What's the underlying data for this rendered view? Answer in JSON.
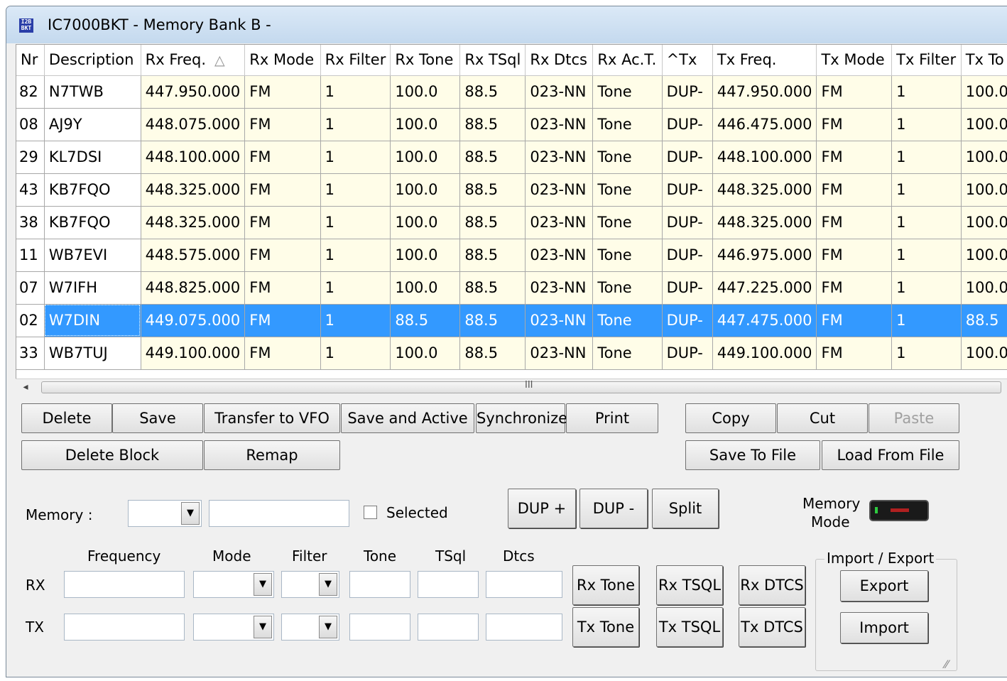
{
  "window": {
    "title": "IC7000BKT - Memory Bank B -",
    "icon_text_top": "I2B",
    "icon_text_bottom": "BKT"
  },
  "grid": {
    "columns": [
      "Nr",
      "Description",
      "Rx Freq.",
      "Rx Mode",
      "Rx Filter",
      "Rx Tone",
      "Rx TSql",
      "Rx Dtcs",
      "Rx Ac.T.",
      "^Tx",
      "Tx Freq.",
      "Tx Mode",
      "Tx Filter",
      "Tx To"
    ],
    "sort_indicator": "△",
    "rows": [
      [
        "82",
        "N7TWB",
        "447.950.000",
        "FM",
        "1",
        "100.0",
        "88.5",
        "023-NN",
        "Tone",
        "DUP-",
        "447.950.000",
        "FM",
        "1",
        "100.0"
      ],
      [
        "08",
        "AJ9Y",
        "448.075.000",
        "FM",
        "1",
        "100.0",
        "88.5",
        "023-NN",
        "Tone",
        "DUP-",
        "446.475.000",
        "FM",
        "1",
        "100.0"
      ],
      [
        "29",
        "KL7DSI",
        "448.100.000",
        "FM",
        "1",
        "100.0",
        "88.5",
        "023-NN",
        "Tone",
        "DUP-",
        "448.100.000",
        "FM",
        "1",
        "100.0"
      ],
      [
        "43",
        "KB7FQO",
        "448.325.000",
        "FM",
        "1",
        "100.0",
        "88.5",
        "023-NN",
        "Tone",
        "DUP-",
        "448.325.000",
        "FM",
        "1",
        "100.0"
      ],
      [
        "38",
        "KB7FQO",
        "448.325.000",
        "FM",
        "1",
        "100.0",
        "88.5",
        "023-NN",
        "Tone",
        "DUP-",
        "448.325.000",
        "FM",
        "1",
        "100.0"
      ],
      [
        "11",
        "WB7EVI",
        "448.575.000",
        "FM",
        "1",
        "100.0",
        "88.5",
        "023-NN",
        "Tone",
        "DUP-",
        "446.975.000",
        "FM",
        "1",
        "100.0"
      ],
      [
        "07",
        "W7IFH",
        "448.825.000",
        "FM",
        "1",
        "100.0",
        "88.5",
        "023-NN",
        "Tone",
        "DUP-",
        "447.225.000",
        "FM",
        "1",
        "100.0"
      ],
      [
        "02",
        "W7DIN",
        "449.075.000",
        "FM",
        "1",
        "88.5",
        "88.5",
        "023-NN",
        "Tone",
        "DUP-",
        "447.475.000",
        "FM",
        "1",
        "88.5"
      ],
      [
        "33",
        "WB7TUJ",
        "449.100.000",
        "FM",
        "1",
        "100.0",
        "88.5",
        "023-NN",
        "Tone",
        "DUP-",
        "449.100.000",
        "FM",
        "1",
        "100.0"
      ]
    ],
    "selected_row": 7
  },
  "scrollbar": {
    "left_arrow": "◂",
    "grip": "III"
  },
  "buttons": {
    "delete": "Delete",
    "save": "Save",
    "transfer_to_vfo": "Transfer to VFO",
    "save_and_active": "Save and Active",
    "synchronize": "Synchronize",
    "print": "Print",
    "copy": "Copy",
    "cut": "Cut",
    "paste": "Paste",
    "delete_block": "Delete  Block",
    "remap": "Remap",
    "save_to_file": "Save To File",
    "load_from_file": "Load From File",
    "dup_plus": "DUP +",
    "dup_minus": "DUP -",
    "split": "Split",
    "rx_tone": "Rx Tone",
    "rx_tsql": "Rx TSQL",
    "rx_dtcs": "Rx DTCS",
    "tx_tone": "Tx Tone",
    "tx_tsql": "Tx TSQL",
    "tx_dtcs": "Tx DTCS",
    "export": "Export",
    "import": "Import"
  },
  "memory": {
    "label": "Memory :",
    "selected_label": "Selected",
    "selected_checked": false,
    "mode_label_line1": "Memory",
    "mode_label_line2": "Mode"
  },
  "editor": {
    "headers": {
      "frequency": "Frequency",
      "mode": "Mode",
      "filter": "Filter",
      "tone": "Tone",
      "tsql": "TSql",
      "dtcs": "Dtcs"
    },
    "rx_label": "RX",
    "tx_label": "TX"
  },
  "import_export": {
    "title": "Import / Export"
  },
  "colors": {
    "row_background": "#fffde8",
    "selection": "#3399ff",
    "led_indicator": "#b02020"
  }
}
